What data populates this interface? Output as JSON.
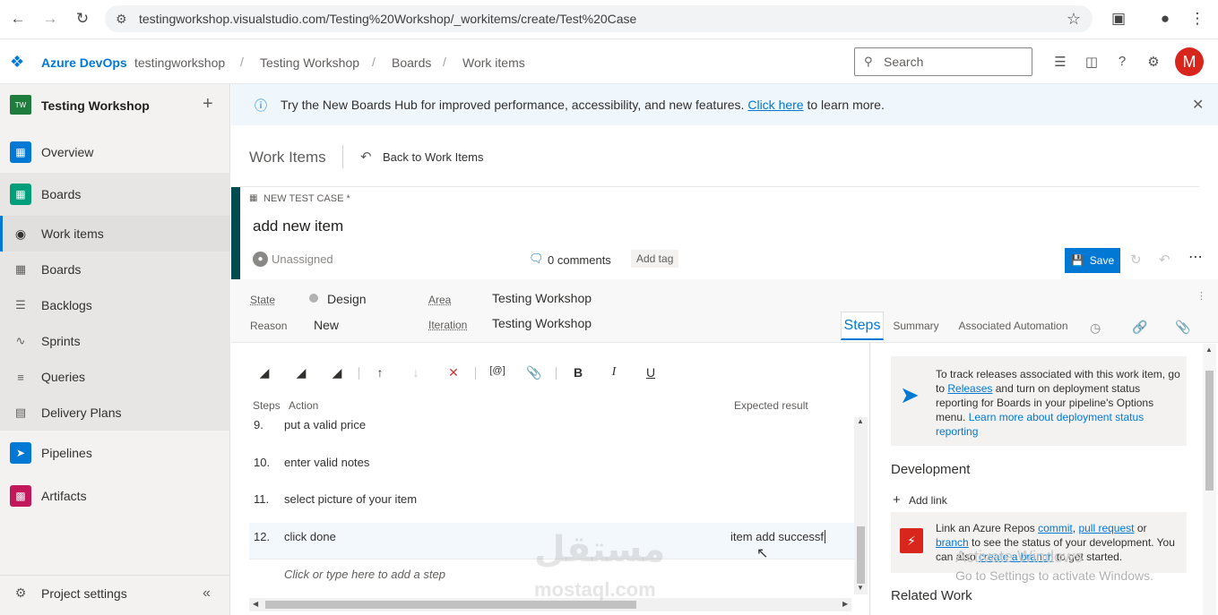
{
  "browser": {
    "url": "testingworkshop.visualstudio.com/Testing%20Workshop/_workitems/create/Test%20Case"
  },
  "topbar": {
    "brand": "Azure DevOps",
    "breadcrumbs": [
      "testingworkshop",
      "Testing Workshop",
      "Boards",
      "Work items"
    ],
    "search_placeholder": "Search",
    "avatar_letter": "M"
  },
  "sidebar": {
    "project_badge": "TW",
    "project_name": "Testing Workshop",
    "items": [
      {
        "label": "Overview"
      },
      {
        "label": "Boards"
      },
      {
        "label": "Work items"
      },
      {
        "label": "Boards"
      },
      {
        "label": "Backlogs"
      },
      {
        "label": "Sprints"
      },
      {
        "label": "Queries"
      },
      {
        "label": "Delivery Plans"
      },
      {
        "label": "Pipelines"
      },
      {
        "label": "Artifacts"
      }
    ],
    "settings_label": "Project settings"
  },
  "banner": {
    "text_before": "Try the New Boards Hub for improved performance, accessibility, and new features.",
    "link": "Click here",
    "text_after": "to learn more."
  },
  "header": {
    "title": "Work Items",
    "back": "Back to Work Items"
  },
  "workitem": {
    "type_label": "NEW TEST CASE *",
    "title": "add new item",
    "assignee": "Unassigned",
    "comments": "0 comments",
    "add_tag": "Add tag",
    "save": "Save"
  },
  "fields": {
    "state_label": "State",
    "state_value": "Design",
    "reason_label": "Reason",
    "reason_value": "New",
    "area_label": "Area",
    "area_value": "Testing Workshop",
    "iteration_label": "Iteration",
    "iteration_value": "Testing Workshop"
  },
  "tabs": [
    "Steps",
    "Summary",
    "Associated Automation"
  ],
  "steps": {
    "col_steps": "Steps",
    "col_action": "Action",
    "col_expected": "Expected result",
    "rows": [
      {
        "num": "9.",
        "action": "put a valid price",
        "expected": ""
      },
      {
        "num": "10.",
        "action": "enter valid notes",
        "expected": ""
      },
      {
        "num": "11.",
        "action": "select picture of your item",
        "expected": ""
      },
      {
        "num": "12.",
        "action": "click done",
        "expected": "item add successf"
      }
    ],
    "add_step": "Click or type here to add a step"
  },
  "right": {
    "deploy_text_1": "To track releases associated with this work item, go to",
    "deploy_link_1": "Releases",
    "deploy_text_2": "and turn on deployment status reporting for Boards in your pipeline's Options menu.",
    "deploy_link_2": "Learn more about deployment status reporting",
    "development_title": "Development",
    "add_link": "Add link",
    "dev_text_1": "Link an Azure Repos",
    "dev_link_commit": "commit",
    "dev_link_pr": "pull request",
    "dev_text_or": "or",
    "dev_link_branch": "branch",
    "dev_text_2": "to see the status of your development. You can also",
    "dev_link_create": "create a branch",
    "dev_text_3": "to get started.",
    "related_title": "Related Work"
  },
  "overlay": {
    "activate_1": "Activate Windows",
    "activate_2": "Go to Settings to activate Windows.",
    "wm_arabic": "مستقل",
    "wm_latin": "mostaql.com"
  },
  "colors": {
    "accent": "#0078d4",
    "save_button": "#0078d4",
    "header_accent": "#004b50",
    "avatar": "#d9261c",
    "delete_red": "#d13438"
  }
}
